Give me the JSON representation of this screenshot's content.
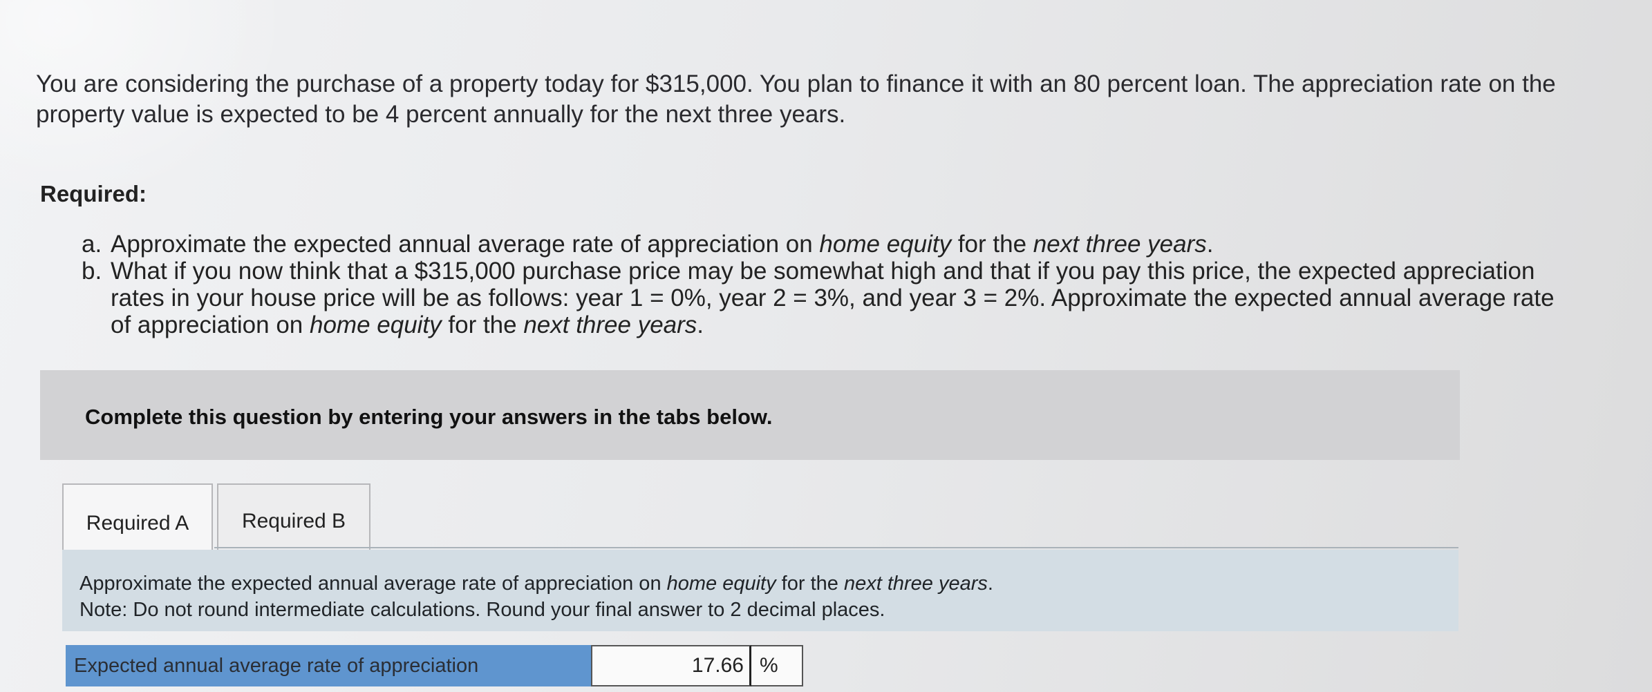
{
  "intro": "You are considering the purchase of a property today for $315,000. You plan to finance it with an 80 percent loan. The appreciation rate on the property value is expected to be 4 percent annually for the next three years.",
  "required_heading": "Required:",
  "requirements": {
    "a": {
      "marker": "a.",
      "text_1": "Approximate the expected annual average rate of appreciation on ",
      "italic_1": "home equity",
      "text_2": " for the ",
      "italic_2": "next three years",
      "text_3": "."
    },
    "b": {
      "marker": "b.",
      "text_1": "What if you now think that a $315,000 purchase price may be somewhat high and that if you pay this price, the expected appreciation rates in your house price will be as follows: year 1 = 0%, year 2 = 3%, and year 3 = 2%. Approximate the expected annual average rate of appreciation on ",
      "italic_1": "home equity",
      "text_2": " for the ",
      "italic_2": "next three years",
      "text_3": "."
    }
  },
  "instruction": "Complete this question by entering your answers in the tabs below.",
  "tabs": [
    {
      "label": "Required A"
    },
    {
      "label": "Required B"
    }
  ],
  "panel": {
    "text_1": "Approximate the expected annual average rate of appreciation on ",
    "italic_1": "home equity",
    "text_2": " for the ",
    "italic_2": "next three years",
    "text_3": ".",
    "note": "Note: Do not round intermediate calculations. Round your final answer to 2 decimal places."
  },
  "answer": {
    "label": "Expected annual average rate of appreciation",
    "value": "17.66",
    "unit": "%"
  }
}
